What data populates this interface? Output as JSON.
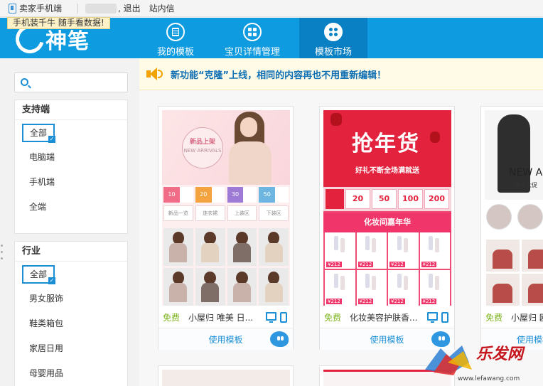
{
  "topbar": {
    "seller_mobile": "卖家手机端",
    "logout": "退出",
    "messages": "站内信",
    "tooltip": "手机装千牛 随手看数据!"
  },
  "header": {
    "logo_text": "神笔",
    "nav": [
      {
        "label": "我的模板",
        "icon": "template-list-icon"
      },
      {
        "label": "宝贝详情管理",
        "icon": "grid-icon"
      },
      {
        "label": "模板市场",
        "icon": "market-grid-icon",
        "active": true
      }
    ],
    "colors": {
      "primary": "#0e9bdf",
      "active": "#0a80c4"
    }
  },
  "sidebar": {
    "search": {
      "placeholder": "",
      "value": ""
    },
    "support": {
      "title": "支持端",
      "items": [
        "全部",
        "电脑端",
        "手机端",
        "全端"
      ]
    },
    "industry": {
      "title": "行业",
      "items": [
        "全部",
        "男女服饰",
        "鞋类箱包",
        "家居日用",
        "母婴用品"
      ]
    }
  },
  "notice": {
    "text": "新功能“克隆”上线，相同的内容再也不用重新编辑！"
  },
  "cards": [
    {
      "free": "免费",
      "title": "小屋归 唯美 日...",
      "use": "使用模板",
      "thumb": {
        "badge_main": "新品上架",
        "badge_sub": "NEW ARRIVALS",
        "coupons": [
          "10",
          "20",
          "30",
          "50"
        ],
        "cats": [
          "新品一览",
          "连衣裙",
          "上装区",
          "下装区"
        ]
      }
    },
    {
      "free": "免费",
      "title": "化妆美容护肤香...",
      "use": "使用模板",
      "thumb": {
        "headline": "抢年货",
        "subline": "好礼不断全场满就送",
        "coupons": [
          "20",
          "50",
          "100",
          "200"
        ],
        "band": "化妆间嘉年华"
      }
    },
    {
      "free": "免费",
      "title": "小屋归 欧",
      "use": "使用模板",
      "thumb": {
        "headline": "NEW A",
        "subline": "年终大促"
      }
    }
  ],
  "watermark": {
    "brand": "乐发网",
    "url": "www.lefawang.com"
  }
}
